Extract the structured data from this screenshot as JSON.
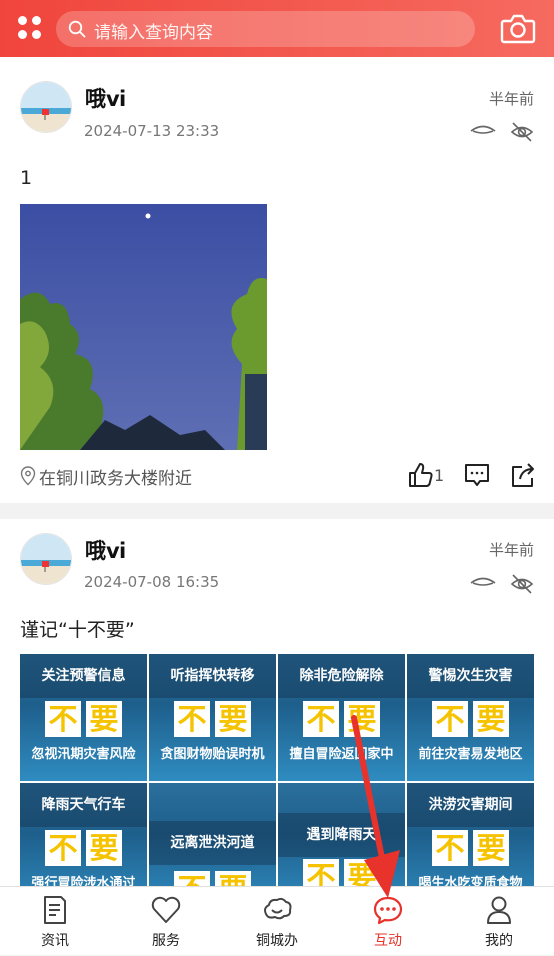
{
  "header": {
    "search_placeholder": "请输入查询内容",
    "menu_icon": "grid-dots-icon",
    "camera_icon": "camera-icon"
  },
  "posts": [
    {
      "username": "哦ⅵ",
      "time": "2024-07-13 23:33",
      "ago": "半年前",
      "text": "1",
      "location": "在铜川政务大楼附近",
      "likes": "1"
    },
    {
      "username": "哦ⅵ",
      "time": "2024-07-08 16:35",
      "ago": "半年前",
      "text": "谨记“十不要”",
      "tiles": [
        {
          "title": "关注预警信息",
          "main": "不要",
          "bottom": "忽视汛期灾害风险"
        },
        {
          "title": "听指挥快转移",
          "main": "不要",
          "bottom": "贪图财物贻误时机"
        },
        {
          "title": "除非危险解除",
          "main": "不要",
          "bottom": "擅自冒险返回家中"
        },
        {
          "title": "警惕次生灾害",
          "main": "不要",
          "bottom": "前往灾害易发地区"
        },
        {
          "title": "降雨天气行车",
          "main": "不要",
          "bottom": "强行冒险涉水通过"
        },
        {
          "title": "远离泄洪河道",
          "main": "不要",
          "bottom": ""
        },
        {
          "title": "遇到降雨天",
          "main": "不要",
          "bottom": ""
        },
        {
          "title": "洪涝灾害期间",
          "main": "不要",
          "bottom": "喝生水吃变质食物"
        }
      ]
    }
  ],
  "tabbar": {
    "items": [
      {
        "label": "资讯",
        "icon": "news-icon"
      },
      {
        "label": "服务",
        "icon": "heart-icon"
      },
      {
        "label": "铜城办",
        "icon": "cloud-icon"
      },
      {
        "label": "互动",
        "icon": "chat-icon"
      },
      {
        "label": "我的",
        "icon": "person-icon"
      }
    ],
    "active_index": 3
  },
  "colors": {
    "brand": "#f0453c",
    "active_tab": "#e8322c",
    "arrow": "#e8322c"
  }
}
